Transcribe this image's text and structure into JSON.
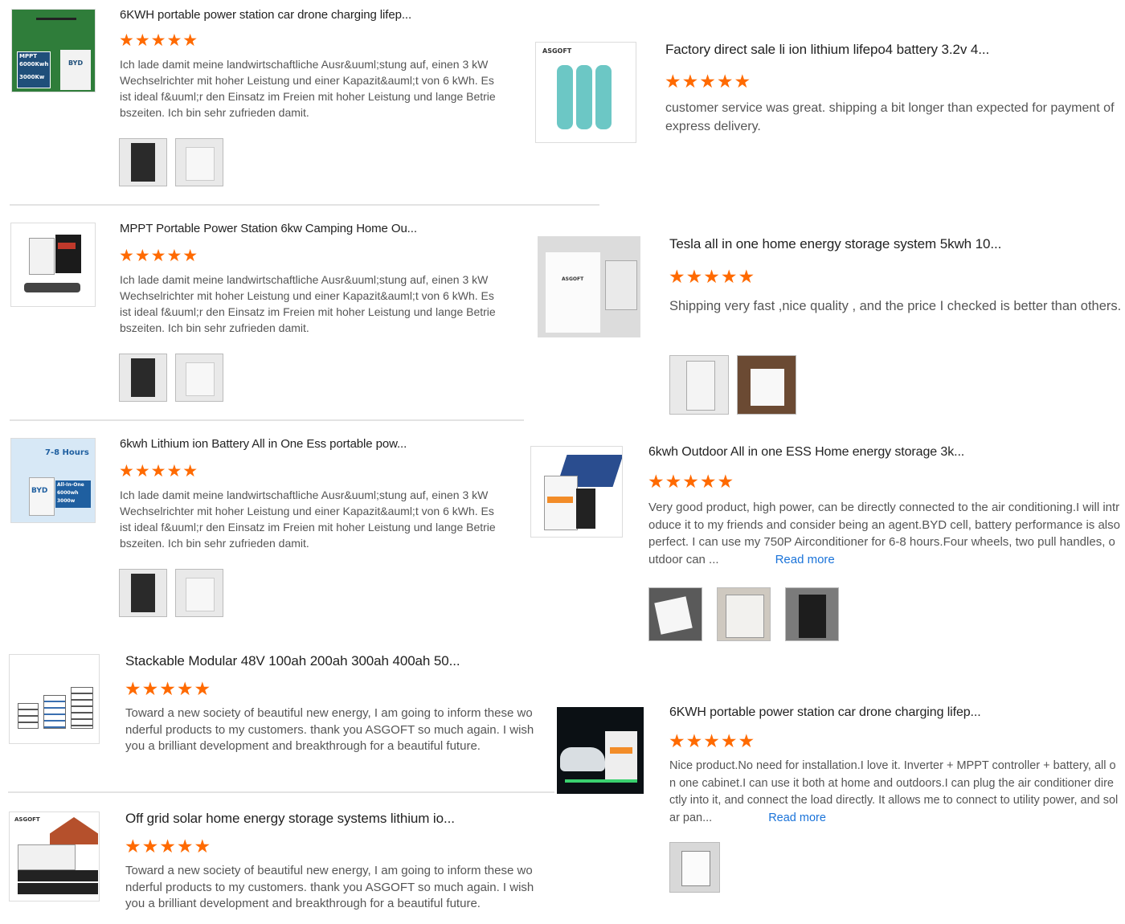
{
  "colors": {
    "star": "#ff6a00",
    "link": "#1a73d9",
    "text": "#555555",
    "title": "#222222"
  },
  "reviews": [
    {
      "title": "6KWH portable power station car drone charging lifep...",
      "stars": "★★★★★",
      "rating": 5,
      "text": "Ich lade damit meine landwirtschaftliche Ausr&uuml;stung auf, einen 3 kW Wechselrichter mit hoher Leistung und einer Kapazit&auml;t von 6 kWh. Es ist ideal f&uuml;r den Einsatz im Freien mit hoher Leistung und lange Betriebszeiten. Ich bin sehr zufrieden damit.",
      "product_img_text": [
        "MPPT",
        "6000Kwh",
        "3000Kw",
        "BYD"
      ]
    },
    {
      "title": "Factory direct sale li ion lithium lifepo4 battery 3.2v 4...",
      "stars": "★★★★★",
      "rating": 5,
      "text": "customer service was great. shipping a bit longer than expected for payment of express delivery.",
      "product_img_text": [
        "ASGOFT"
      ]
    },
    {
      "title": "MPPT Portable Power Station 6kw Camping Home Ou...",
      "stars": "★★★★★",
      "rating": 5,
      "text": "Ich lade damit meine landwirtschaftliche Ausr&uuml;stung auf, einen 3 kW Wechselrichter mit hoher Leistung und einer Kapazit&auml;t von 6 kWh. Es ist ideal f&uuml;r den Einsatz im Freien mit hoher Leistung und lange Betriebszeiten. Ich bin sehr zufrieden damit."
    },
    {
      "title": "Tesla all in one home energy storage system 5kwh 10...",
      "stars": "★★★★★",
      "rating": 5,
      "text": "Shipping very fast ,nice quality , and the price I checked is better than others.",
      "product_img_text": [
        "ASGOFT"
      ]
    },
    {
      "title": "6kwh Lithium ion Battery All in One Ess portable pow...",
      "stars": "★★★★★",
      "rating": 5,
      "text": "Ich lade damit meine landwirtschaftliche Ausr&uuml;stung auf, einen 3 kW Wechselrichter mit hoher Leistung und einer Kapazit&auml;t von 6 kWh. Es ist ideal f&uuml;r den Einsatz im Freien mit hoher Leistung und lange Betriebszeiten. Ich bin sehr zufrieden damit.",
      "product_img_text": [
        "7-8 Hours",
        "BYD",
        "All-In-One",
        "6000wh",
        "3000w"
      ]
    },
    {
      "title": "6kwh Outdoor All in one ESS Home energy storage 3k...",
      "stars": "★★★★★",
      "rating": 5,
      "text": "Very good product, high power, can be directly connected to the air conditioning.I will introduce it to my friends and consider being an agent.BYD cell, battery performance is also perfect. I can use my 750P Airconditioner for 6-8 hours.Four wheels, two pull handles, outdoor can ...",
      "read_more": "Read more"
    },
    {
      "title": "Stackable Modular 48V 100ah 200ah 300ah 400ah 50...",
      "stars": "★★★★★",
      "rating": 5,
      "text": "Toward a new society of beautiful new energy, I am going to inform these wonderful products to my customers. thank you ASGOFT so much again. I wish you a brilliant development and breakthrough for a beautiful future."
    },
    {
      "title": "6KWH portable power station car drone charging lifep...",
      "stars": "★★★★★",
      "rating": 5,
      "text": "Nice product.No need for installation.I love it. Inverter + MPPT controller + battery, all on one cabinet.I can use it both at home and outdoors.I can plug the air conditioner directly into it, and connect the load directly. It allows me to connect to utility power, and solar pan...",
      "read_more": "Read more"
    },
    {
      "title": "Off grid solar home energy storage systems lithium io...",
      "stars": "★★★★★",
      "rating": 5,
      "text": "Toward a new society of beautiful new energy, I am going to inform these wonderful products to my customers. thank you ASGOFT so much again. I wish you a brilliant development and breakthrough for a beautiful future.",
      "product_img_text": [
        "ASGOFT"
      ]
    }
  ]
}
